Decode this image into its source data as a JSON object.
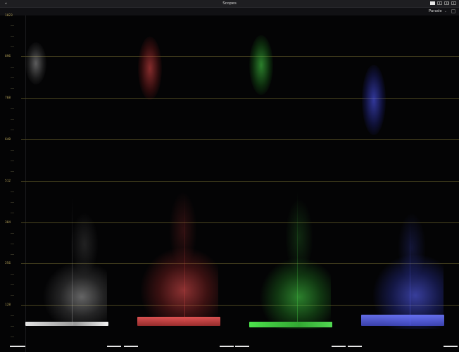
{
  "window": {
    "title": "Scopes"
  },
  "toolbar": {
    "mode": "Parade"
  },
  "scale": {
    "labels": [
      "1023",
      "896",
      "768",
      "640",
      "512",
      "384",
      "256",
      "128"
    ]
  },
  "channels": [
    {
      "name": "luma",
      "color": "#d8d8d8"
    },
    {
      "name": "red",
      "color": "#e04848"
    },
    {
      "name": "green",
      "color": "#3fd03f"
    },
    {
      "name": "blue",
      "color": "#5058ff"
    }
  ]
}
